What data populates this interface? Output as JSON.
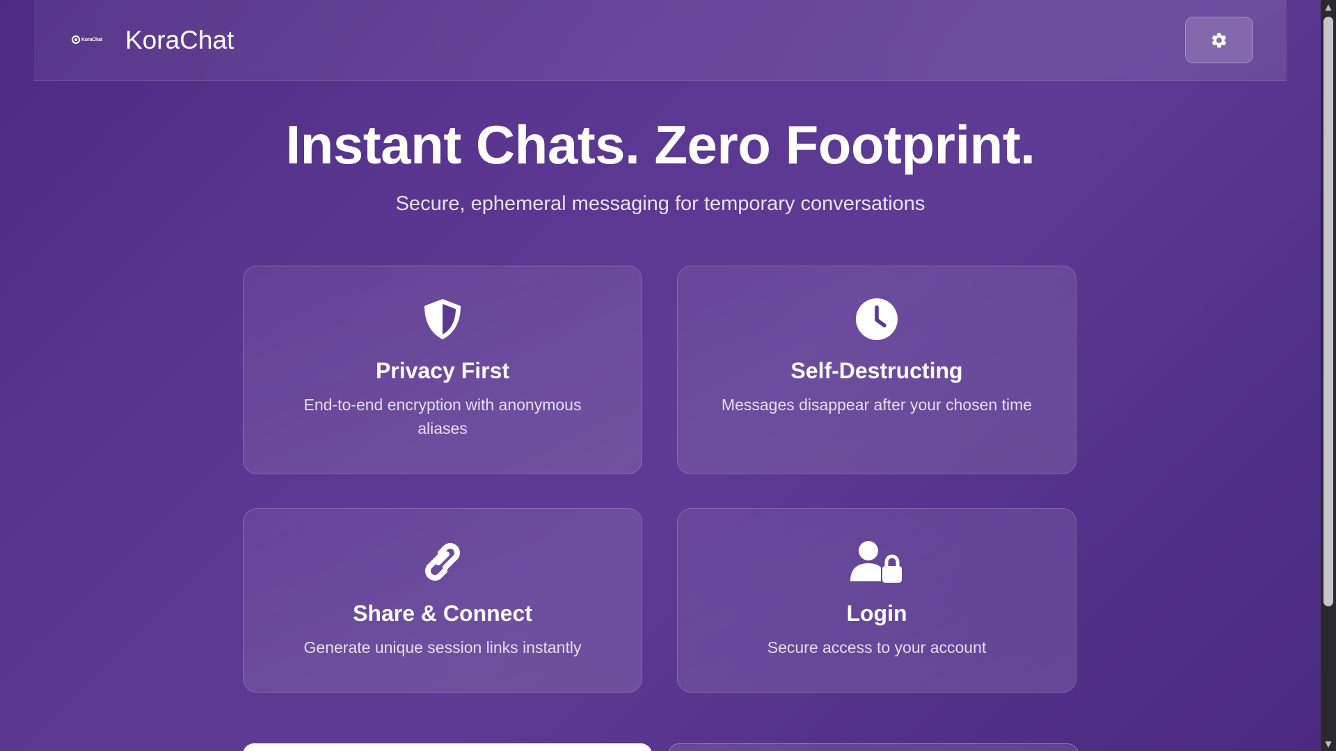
{
  "header": {
    "logo_text": "KoraChat",
    "brand": "KoraChat",
    "settings_icon": "gear-icon"
  },
  "hero": {
    "title": "Instant Chats. Zero Footprint.",
    "subtitle": "Secure, ephemeral messaging for temporary conversations"
  },
  "features": [
    {
      "icon": "shield-icon",
      "title": "Privacy First",
      "description": "End-to-end encryption with anonymous aliases"
    },
    {
      "icon": "clock-icon",
      "title": "Self-Destructing",
      "description": "Messages disappear after your chosen time"
    },
    {
      "icon": "link-icon",
      "title": "Share & Connect",
      "description": "Generate unique session links instantly"
    },
    {
      "icon": "user-lock-icon",
      "title": "Login",
      "description": "Secure access to your account"
    }
  ],
  "colors": {
    "background": "#56338c",
    "text": "#ffffff",
    "primary_button": "#ffffff"
  }
}
